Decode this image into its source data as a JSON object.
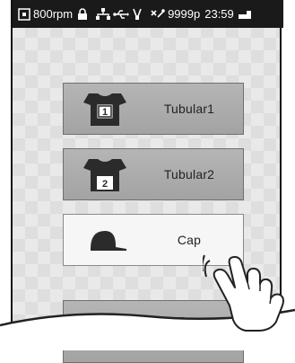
{
  "status_bar": {
    "speed": "800rpm",
    "stitch_count": "9999p",
    "time": "23:59",
    "icons": [
      "frame-icon",
      "lock-icon",
      "network-icon",
      "usb-icon",
      "pen-icon",
      "stitch-icon",
      "battery-icon"
    ]
  },
  "buttons": [
    {
      "label": "Tubular1",
      "icon": "tubular-1-icon",
      "number": "1"
    },
    {
      "label": "Tubular2",
      "icon": "tubular-2-icon",
      "number": "2"
    },
    {
      "label": "Cap",
      "icon": "cap-icon"
    }
  ],
  "colors": {
    "status_bar_bg": "#1a1a1a",
    "button_dark": "#aaaaaa",
    "button_light": "#f6f6f6",
    "screen_bg": "#e9e9e9"
  }
}
